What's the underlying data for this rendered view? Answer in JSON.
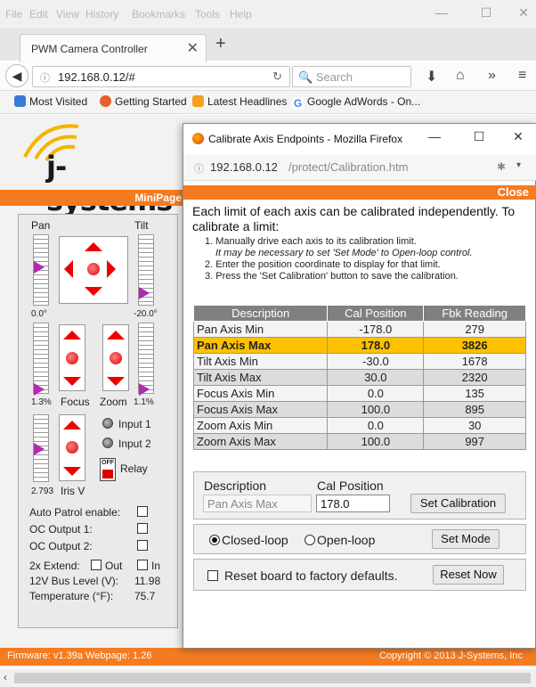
{
  "menubar": {
    "items": [
      "File",
      "Edit",
      "View",
      "History",
      "Bookmarks",
      "Tools",
      "Help"
    ]
  },
  "tab": {
    "title": "PWM Camera Controller"
  },
  "nav": {
    "url": "192.168.0.12/#",
    "search_placeholder": "Search"
  },
  "bookmarks": [
    "Most Visited",
    "Getting Started",
    "Latest Headlines",
    "Google AdWords - On..."
  ],
  "page": {
    "logo_text": "j-systems",
    "minipage_label": "MiniPage",
    "pan_label": "Pan",
    "tilt_label": "Tilt",
    "pan_value": "0.0°",
    "tilt_value": "-20.0°",
    "focus_pct": "1.3%",
    "focus_label": "Focus",
    "zoom_label": "Zoom",
    "zoom_pct": "1.1%",
    "iris_value": "2.793",
    "iris_label": "Iris V",
    "input1": "Input 1",
    "input2": "Input 2",
    "relay_label": "Relay",
    "relay_switch": "OFF",
    "auto_patrol": "Auto Patrol enable:",
    "oc1": "OC Output 1:",
    "oc2": "OC Output 2:",
    "extend": "2x Extend:",
    "out": "Out",
    "in": "In",
    "bus_label": "12V Bus Level (V):",
    "bus_value": "11.98",
    "temp_label": "Temperature (°F):",
    "temp_value": "75.7",
    "firmware": "Firmware: v1.39a  Webpage: 1.26",
    "copyright": "Copyright © 2013 J-Systems, Inc"
  },
  "popup": {
    "title": "Calibrate Axis Endpoints - Mozilla Firefox",
    "url_gray": "192.168.0.12",
    "url_path": "/protect/Calibration.htm",
    "close": "Close",
    "intro": "Each limit of each axis can be calibrated independently. To calibrate a limit:",
    "step1": "1. Manually drive each axis to its calibration limit.",
    "step1b": "It may be necessary to set 'Set Mode' to Open-loop control.",
    "step2": "2. Enter the position coordinate to display for that limit.",
    "step3": "3. Press the 'Set Calibration' button to save the calibration.",
    "columns": [
      "Description",
      "Cal Position",
      "Fbk Reading"
    ],
    "rows": [
      [
        "Pan Axis Min",
        "-178.0",
        "279"
      ],
      [
        "Pan Axis Max",
        "178.0",
        "3826"
      ],
      [
        "Tilt Axis Min",
        "-30.0",
        "1678"
      ],
      [
        "Tilt Axis Max",
        "30.0",
        "2320"
      ],
      [
        "Focus Axis Min",
        "0.0",
        "135"
      ],
      [
        "Focus Axis Max",
        "100.0",
        "895"
      ],
      [
        "Zoom Axis Min",
        "0.0",
        "30"
      ],
      [
        "Zoom Axis Max",
        "100.0",
        "997"
      ]
    ],
    "selected_row": 1,
    "desc_label": "Description",
    "calpos_label": "Cal Position",
    "desc_value": "Pan Axis Max",
    "calpos_value": "178.0",
    "set_cal": "Set Calibration",
    "closed_loop": "Closed-loop",
    "open_loop": "Open-loop",
    "set_mode": "Set Mode",
    "reset_text": "Reset board to factory defaults.",
    "reset_now": "Reset Now"
  },
  "colors": {
    "accent": "#f47b20",
    "selected_row": "#ffc000",
    "header": "#808080",
    "arrow": "#ee0000"
  }
}
